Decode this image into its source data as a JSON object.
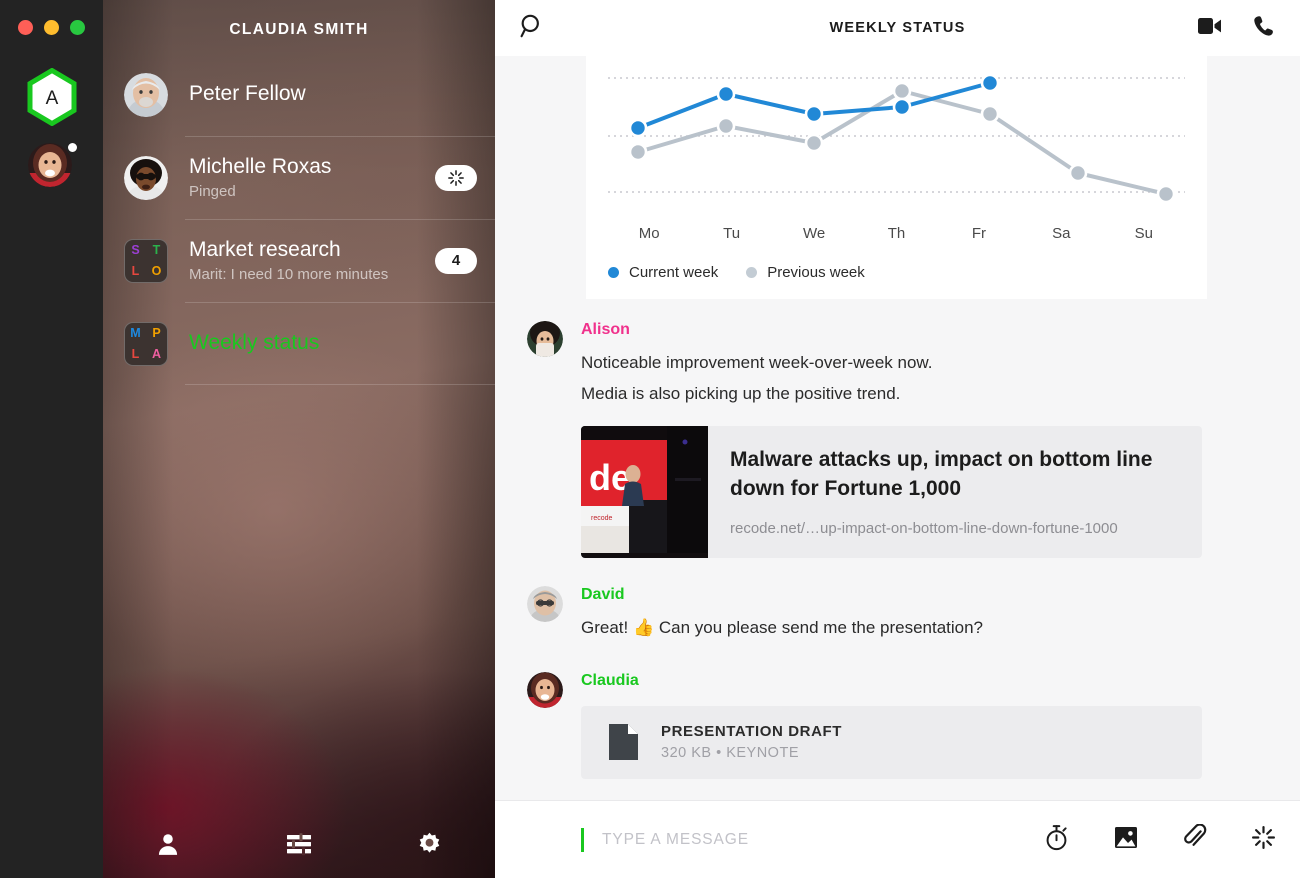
{
  "window": {
    "traffic_lights": [
      "close",
      "minimize",
      "maximize"
    ],
    "colors": {
      "close": "#ff5f57",
      "minimize": "#febc2e",
      "maximize": "#28c840"
    }
  },
  "rail": {
    "workspace_initial": "A",
    "workspace_ring_color": "#19c81f",
    "account_badge": "unread-dot"
  },
  "sidebar": {
    "title": "CLAUDIA SMITH",
    "conversations": [
      {
        "name": "Peter Fellow",
        "subtitle": "",
        "avatar_type": "photo",
        "badge": "",
        "active": false
      },
      {
        "name": "Michelle Roxas",
        "subtitle": "Pinged",
        "avatar_type": "photo",
        "badge": "ping-icon",
        "active": false
      },
      {
        "name": "Market research",
        "subtitle": "Marit: I need 10 more minutes",
        "avatar_type": "group",
        "group_letters": [
          {
            "ch": "S",
            "color": "#9b3fd4"
          },
          {
            "ch": "T",
            "color": "#2bb24c"
          },
          {
            "ch": "L",
            "color": "#e8473f"
          },
          {
            "ch": "O",
            "color": "#f0a000"
          }
        ],
        "badge": "4",
        "active": false
      },
      {
        "name": "Weekly status",
        "subtitle": "",
        "avatar_type": "group",
        "group_letters": [
          {
            "ch": "M",
            "color": "#1e8ae0"
          },
          {
            "ch": "P",
            "color": "#f0a000"
          },
          {
            "ch": "L",
            "color": "#e8473f"
          },
          {
            "ch": "A",
            "color": "#ef5fa0"
          }
        ],
        "badge": "",
        "active": true
      }
    ],
    "footer_buttons": [
      {
        "label": "Contacts",
        "icon": "person-icon"
      },
      {
        "label": "Filters",
        "icon": "sliders-icon"
      },
      {
        "label": "Settings",
        "icon": "gear-icon"
      }
    ],
    "active_color": "#19c81f"
  },
  "topbar": {
    "title": "WEEKLY STATUS",
    "search_icon": "search-icon",
    "video_call_icon": "video-camera-icon",
    "voice_call_icon": "phone-icon"
  },
  "chart_data": {
    "type": "line",
    "title": "",
    "xlabel": "",
    "ylabel": "",
    "categories": [
      "Mo",
      "Tu",
      "We",
      "Th",
      "Fr",
      "Sa",
      "Su"
    ],
    "ylim": [
      0,
      100
    ],
    "grid": true,
    "gridlines": [
      20,
      60,
      100
    ],
    "legend_position": "bottom-left",
    "series": [
      {
        "name": "Current week",
        "color": "#2188d6",
        "values": [
          60,
          80,
          68,
          71,
          90,
          null,
          null
        ]
      },
      {
        "name": "Previous week",
        "color": "#b9c2cb",
        "values": [
          52,
          65,
          58,
          83,
          68,
          33,
          27
        ]
      }
    ]
  },
  "messages": [
    {
      "author": "Alison",
      "author_color": "#f0318c",
      "avatar": "alison-avatar",
      "lines": [
        "Noticeable improvement week-over-week now.",
        "Media is also picking up the positive trend."
      ],
      "link_preview": {
        "title": "Malware attacks up, impact on bottom line down for Fortune 1,000",
        "url": "recode.net/…up-impact-on-bottom-line-down-fortune-1000"
      }
    },
    {
      "author": "David",
      "author_color": "#19c81f",
      "avatar": "david-avatar",
      "lines": [
        "Great! 👍 Can you please send me the presentation?"
      ]
    },
    {
      "author": "Claudia",
      "author_color": "#19c81f",
      "avatar": "claudia-avatar",
      "lines": [],
      "file": {
        "name": "PRESENTATION DRAFT",
        "meta": "320 KB • KEYNOTE",
        "icon": "document-icon"
      }
    }
  ],
  "composer": {
    "placeholder": "TYPE A MESSAGE",
    "value": "",
    "caret_color": "#19c81f",
    "actions": [
      {
        "label": "Timer",
        "icon": "stopwatch-icon"
      },
      {
        "label": "Image",
        "icon": "image-icon"
      },
      {
        "label": "Attachment",
        "icon": "paperclip-icon"
      },
      {
        "label": "Ping",
        "icon": "ping-icon"
      }
    ]
  }
}
